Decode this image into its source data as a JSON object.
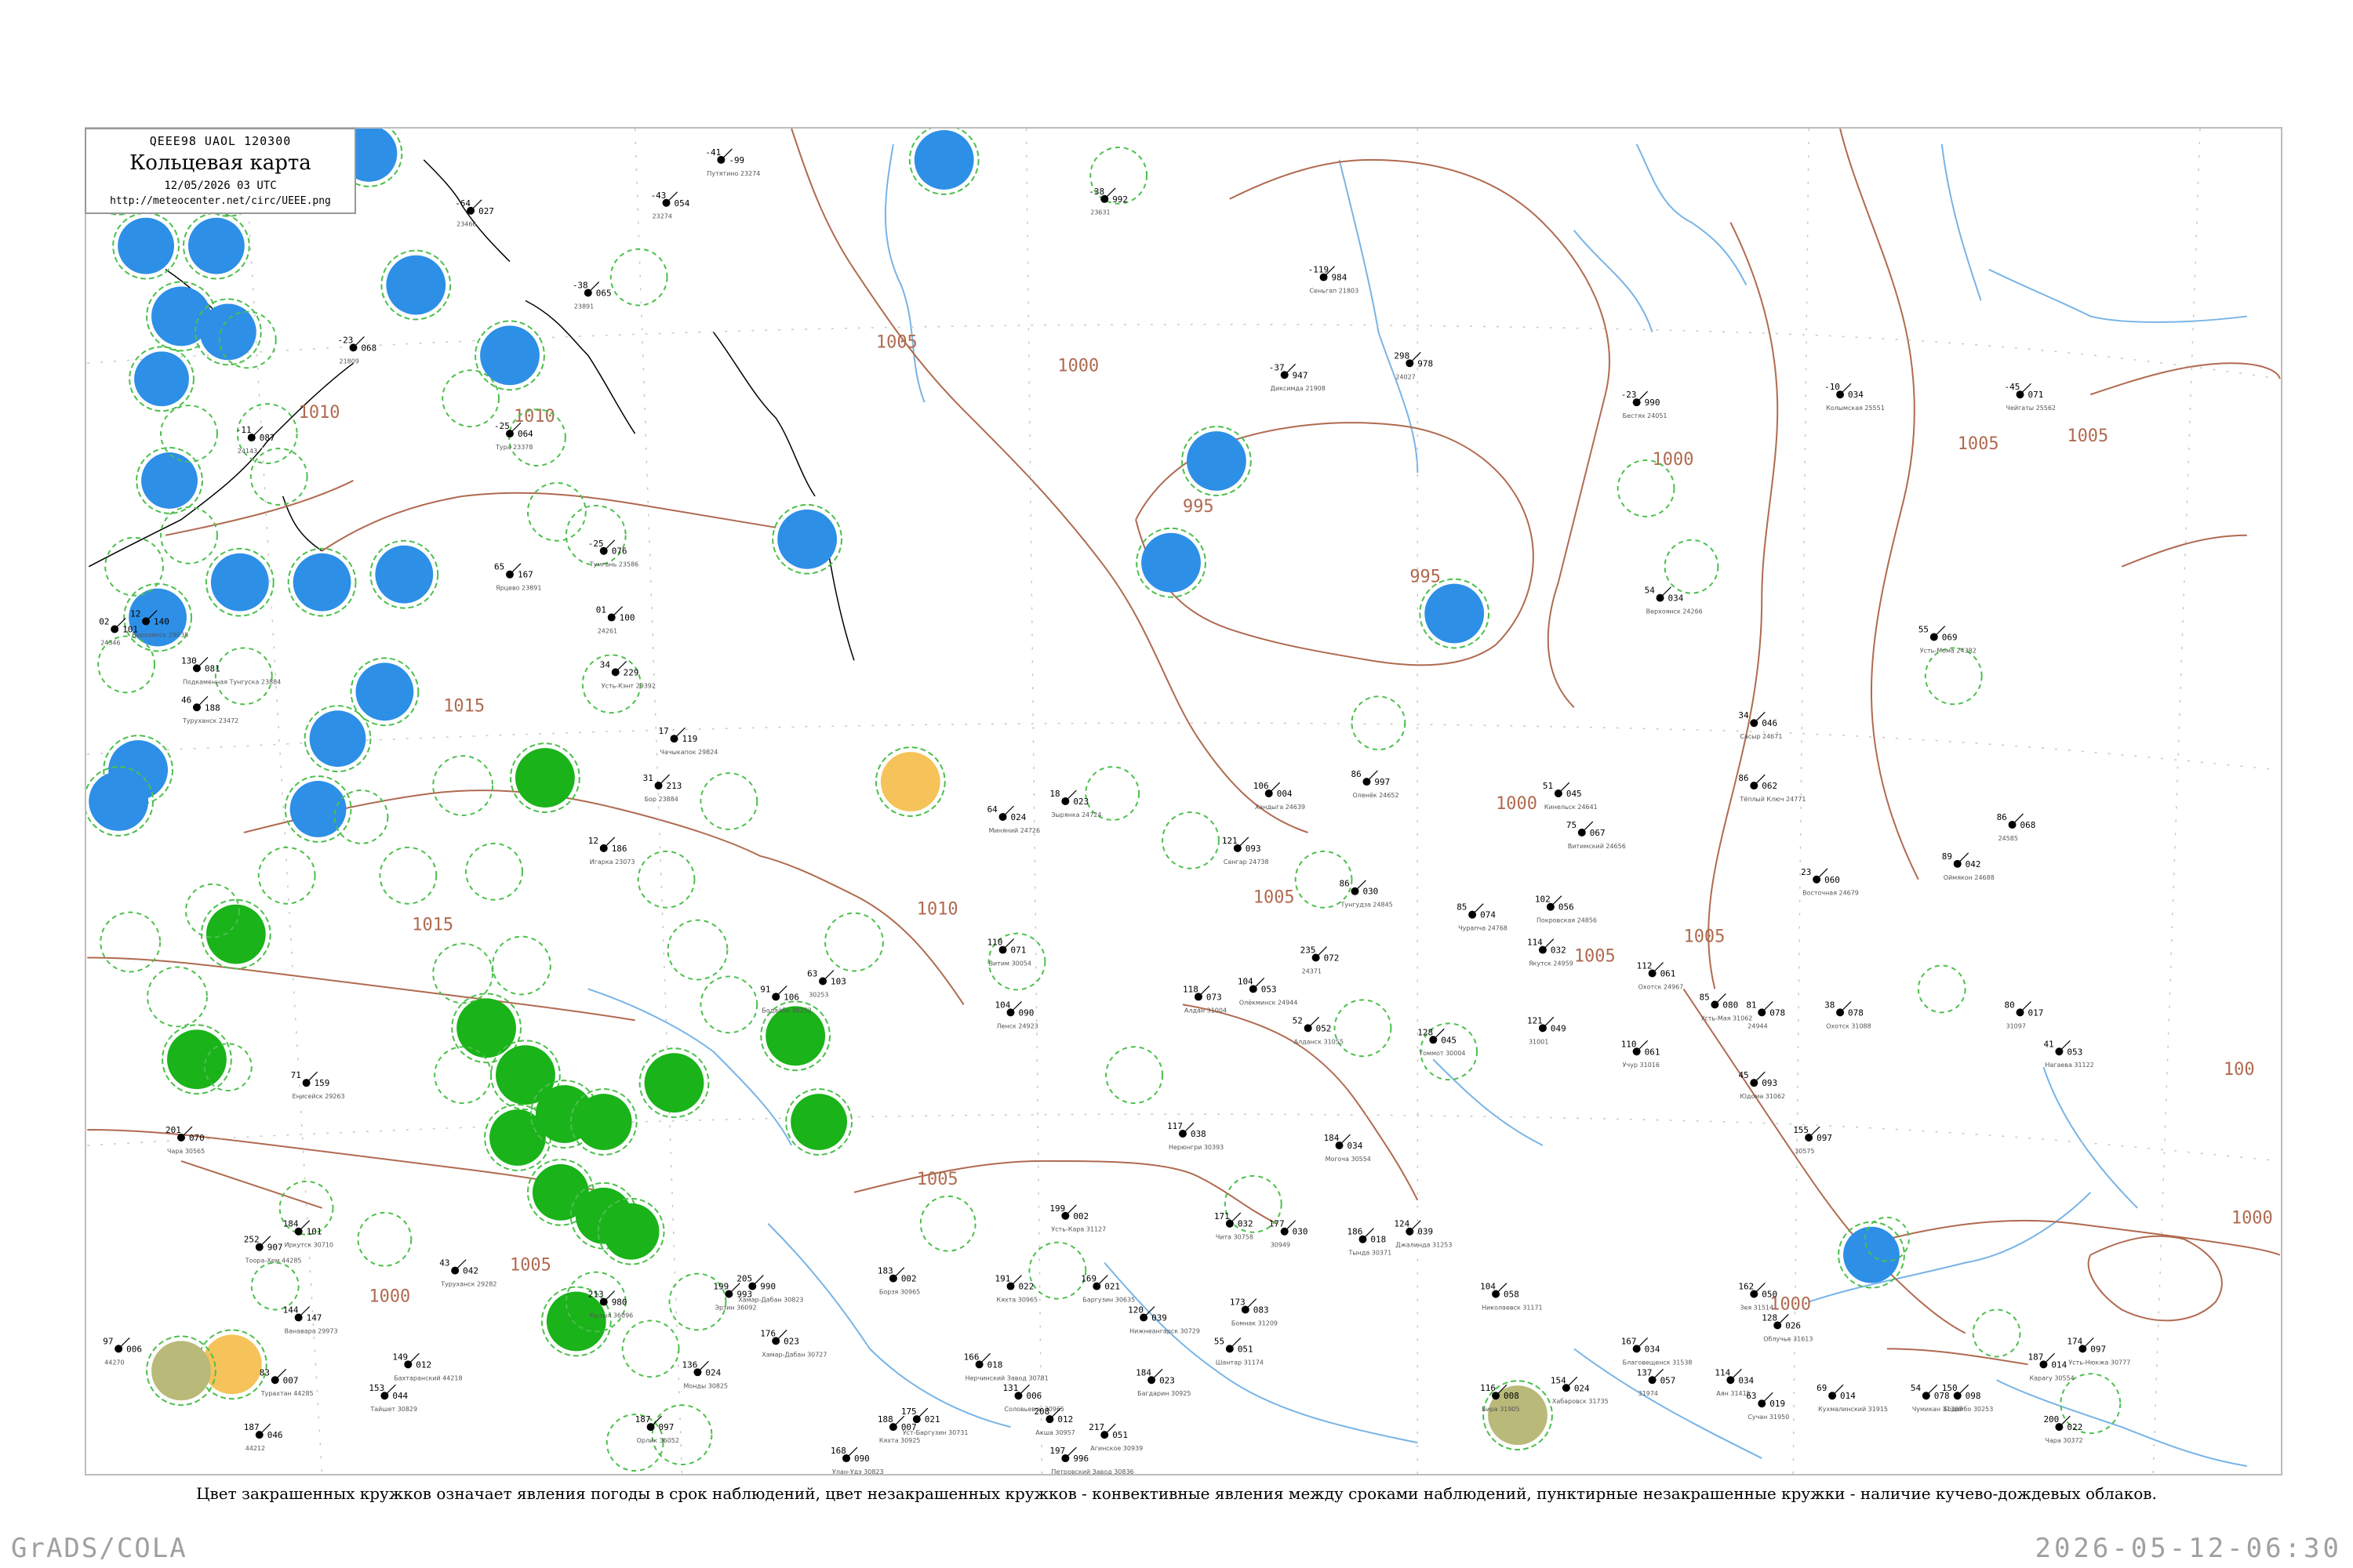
{
  "title_box": {
    "code": "QEEE98  UAOL  120300",
    "title": "Кольцевая карта",
    "datetime": "12/05/2026 03 UTC",
    "url": "http://meteocenter.net/circ/UEEE.png"
  },
  "caption": "Цвет закрашенных кружков означает явления погоды в срок наблюдений, цвет незакрашенных кружков - конвективные явления между сроками наблюдений, пунктирные незакрашенные кружки - наличие кучево-дождевых облаков.",
  "footer": {
    "left": "GrADS/COLA",
    "right": "2026-05-12-06:30"
  },
  "colors": {
    "frame": "#bdbdbd",
    "isobar": "#b06a50",
    "river": "#78b4e6",
    "shower_circle": "#2e8fe6",
    "thunder_circle": "#1ab31a",
    "fog_circle": "#f5c35a",
    "haze_circle": "#b9b97a",
    "convective_ring": "#4cbf4c"
  },
  "isobar_labels": [
    "1005",
    "1000",
    "1010",
    "1010",
    "995",
    "1015",
    "1015",
    "1010",
    "1005",
    "1005",
    "1000",
    "995",
    "1000",
    "1005",
    "1000",
    "1005",
    "1005",
    "1005",
    "1000",
    "1005",
    "100",
    "1000"
  ],
  "stations": [
    {
      "t": "-41",
      "p": "-99",
      "name": "Путятино 23274"
    },
    {
      "t": "-64",
      "p": "027",
      "name": "23466"
    },
    {
      "t": "-43",
      "p": "054",
      "name": "23274"
    },
    {
      "t": "-38",
      "p": "992",
      "name": "23631"
    },
    {
      "t": "-119",
      "p": "984",
      "name": "Сеньгап 21803"
    },
    {
      "t": "-23",
      "p": "068",
      "name": "21809"
    },
    {
      "t": "-37",
      "p": "947",
      "name": "Диксимда 21908"
    },
    {
      "t": "298",
      "p": "978",
      "name": "24027"
    },
    {
      "t": "-23",
      "p": "990",
      "name": "Бестях 24051"
    },
    {
      "t": "-10",
      "p": "034",
      "name": "Колымская 25551"
    },
    {
      "t": "-45",
      "p": "071",
      "name": "Чейгаты 25562"
    },
    {
      "t": "-25",
      "p": "064",
      "name": "Тура 23378"
    },
    {
      "t": "-38",
      "p": "065",
      "name": "23891"
    },
    {
      "t": "-11",
      "p": "087",
      "name": "24143"
    },
    {
      "t": "-25",
      "p": "076",
      "name": "Тумгань 23586"
    },
    {
      "t": "01",
      "p": "100",
      "name": "24261"
    },
    {
      "t": "02",
      "p": "101",
      "name": "24346"
    },
    {
      "t": "12",
      "p": "140",
      "name": "Верхоянск 29038"
    },
    {
      "t": "54",
      "p": "034",
      "name": "Верхоянск 24266"
    },
    {
      "t": "55",
      "p": "069",
      "name": "Усть-Мома 24382"
    },
    {
      "t": "34",
      "p": "229",
      "name": "Усть-Кэнт 29392"
    },
    {
      "t": "17",
      "p": "119",
      "name": "Чачыкапок 29824"
    },
    {
      "t": "18",
      "p": "023",
      "name": "Зырянка 24724"
    },
    {
      "t": "86",
      "p": "997",
      "name": "Оленёк 24652"
    },
    {
      "t": "106",
      "p": "004",
      "name": "Хандыга 24639"
    },
    {
      "t": "64",
      "p": "024",
      "name": "Миняний 24726"
    },
    {
      "t": "121",
      "p": "093",
      "name": "Сангар 24738"
    },
    {
      "t": "51",
      "p": "045",
      "name": "Кинельск 24641"
    },
    {
      "t": "75",
      "p": "067",
      "name": "Витимский 24656"
    },
    {
      "t": "34",
      "p": "046",
      "name": "Сасыр 24671"
    },
    {
      "t": "86",
      "p": "062",
      "name": "Тёплый Ключ 24771"
    },
    {
      "t": "23",
      "p": "060",
      "name": "Восточная 24679"
    },
    {
      "t": "89",
      "p": "042",
      "name": "Оймякон 24688"
    },
    {
      "t": "86",
      "p": "068",
      "name": "24585"
    },
    {
      "t": "86",
      "p": "030",
      "name": "Тунгудза 24845"
    },
    {
      "t": "102",
      "p": "056",
      "name": "Покровская 24856"
    },
    {
      "t": "85",
      "p": "074",
      "name": "Чурапча 24768"
    },
    {
      "t": "114",
      "p": "032",
      "name": "Якутск 24959"
    },
    {
      "t": "235",
      "p": "072",
      "name": "24371"
    },
    {
      "t": "110",
      "p": "071",
      "name": "Витим 30054"
    },
    {
      "t": "104",
      "p": "090",
      "name": "Ленск 24923"
    },
    {
      "t": "91",
      "p": "106",
      "name": "Бодайбо 30252"
    },
    {
      "t": "63",
      "p": "103",
      "name": "30253"
    },
    {
      "t": "118",
      "p": "073",
      "name": "Алдан 31004"
    },
    {
      "t": "104",
      "p": "053",
      "name": "Олёкминск 24944"
    },
    {
      "t": "52",
      "p": "052",
      "name": "Алданск 31055"
    },
    {
      "t": "128",
      "p": "045",
      "name": "Томмот 30004"
    },
    {
      "t": "121",
      "p": "049",
      "name": "31001"
    },
    {
      "t": "110",
      "p": "061",
      "name": "Учур 31016"
    },
    {
      "t": "112",
      "p": "061",
      "name": "Охотск 24967"
    },
    {
      "t": "85",
      "p": "080",
      "name": "Усть-Мая 31062"
    },
    {
      "t": "81",
      "p": "078",
      "name": "24944"
    },
    {
      "t": "45",
      "p": "093",
      "name": "Юдома 31062"
    },
    {
      "t": "38",
      "p": "078",
      "name": "Охотск 31088"
    },
    {
      "t": "80",
      "p": "017",
      "name": "31097"
    },
    {
      "t": "41",
      "p": "053",
      "name": "Нагаева 31122"
    },
    {
      "t": "155",
      "p": "097",
      "name": "30575"
    },
    {
      "t": "117",
      "p": "038",
      "name": "Нерюнгри 30393"
    },
    {
      "t": "184",
      "p": "034",
      "name": "Могоча 30554"
    },
    {
      "t": "171",
      "p": "032",
      "name": "Чита 30758"
    },
    {
      "t": "177",
      "p": "030",
      "name": "30949"
    },
    {
      "t": "186",
      "p": "018",
      "name": "Тында 30371"
    },
    {
      "t": "124",
      "p": "039",
      "name": "Джалинда 31253"
    },
    {
      "t": "173",
      "p": "083",
      "name": "Бомнак 31209"
    },
    {
      "t": "104",
      "p": "058",
      "name": "Николаевск 31171"
    },
    {
      "t": "55",
      "p": "051",
      "name": "Шантар 31174"
    },
    {
      "t": "167",
      "p": "034",
      "name": "Благовещенск 31538"
    },
    {
      "t": "162",
      "p": "050",
      "name": "Зея 31514"
    },
    {
      "t": "128",
      "p": "026",
      "name": "Облучье 31613"
    },
    {
      "t": "116",
      "p": "008",
      "name": "Бира 31905"
    },
    {
      "t": "154",
      "p": "024",
      "name": "Хабаровск 31735"
    },
    {
      "t": "137",
      "p": "057",
      "name": "31974"
    },
    {
      "t": "114",
      "p": "034",
      "name": "Аян 31415"
    },
    {
      "t": "63",
      "p": "019",
      "name": "Сучан 31950"
    },
    {
      "t": "69",
      "p": "014",
      "name": "Кухмалинский 31915"
    },
    {
      "t": "54",
      "p": "078",
      "name": "Чумикан 31369"
    },
    {
      "t": "150",
      "p": "098",
      "name": "Бодайбо 30253"
    },
    {
      "t": "187",
      "p": "014",
      "name": "Карагу 30554"
    },
    {
      "t": "200",
      "p": "022",
      "name": "Чара 30372"
    },
    {
      "t": "174",
      "p": "097",
      "name": "Усть-Нюкжа 30777"
    },
    {
      "t": "201",
      "p": "070",
      "name": "Чара 30565"
    },
    {
      "t": "199",
      "p": "002",
      "name": "Усть-Кара 31127"
    },
    {
      "t": "169",
      "p": "021",
      "name": "Баргузин 30635"
    },
    {
      "t": "120",
      "p": "039",
      "name": "Нижнеангарск 30729"
    },
    {
      "t": "184",
      "p": "023",
      "name": "Багдарин 30925"
    },
    {
      "t": "191",
      "p": "022",
      "name": "Кяхта 30965"
    },
    {
      "t": "183",
      "p": "002",
      "name": "Борзя 30965"
    },
    {
      "t": "166",
      "p": "018",
      "name": "Нерчинский Завод 30781"
    },
    {
      "t": "131",
      "p": "006",
      "name": "Соловьевск 30965"
    },
    {
      "t": "208",
      "p": "012",
      "name": "Акша 30957"
    },
    {
      "t": "217",
      "p": "051",
      "name": "Агинское 30939"
    },
    {
      "t": "197",
      "p": "996",
      "name": "Петровский Завод 30836"
    },
    {
      "t": "188",
      "p": "007",
      "name": "Кяхта 30925"
    },
    {
      "t": "168",
      "p": "090",
      "name": "Улан-Удэ 30823"
    },
    {
      "t": "175",
      "p": "021",
      "name": "Уст-Баргузин 30731"
    },
    {
      "t": "176",
      "p": "023",
      "name": "Хамар-Дабан 30727"
    },
    {
      "t": "136",
      "p": "024",
      "name": "Монды 30825"
    },
    {
      "t": "187",
      "p": "097",
      "name": "Орлик 36052"
    },
    {
      "t": "205",
      "p": "990",
      "name": "Хамар-Дабан 30823"
    },
    {
      "t": "213",
      "p": "980",
      "name": "Кызыл 36096"
    },
    {
      "t": "199",
      "p": "993",
      "name": "Эрзин 36092"
    },
    {
      "t": "252",
      "p": "907",
      "name": "Тоора-Хем 44285"
    },
    {
      "t": "184",
      "p": "101",
      "name": "Иркутск 30710"
    },
    {
      "t": "149",
      "p": "012",
      "name": "Бахтаранский 44218"
    },
    {
      "t": "187",
      "p": "046",
      "name": "44212"
    },
    {
      "t": "97",
      "p": "006",
      "name": "44270"
    },
    {
      "t": "83",
      "p": "007",
      "name": "Турахтан 44285"
    },
    {
      "t": "153",
      "p": "044",
      "name": "Тайшет 30829"
    },
    {
      "t": "144",
      "p": "147",
      "name": "Ванавара 29973"
    },
    {
      "t": "43",
      "p": "042",
      "name": "Туруханск 29282"
    },
    {
      "t": "71",
      "p": "159",
      "name": "Енисейск 29263"
    },
    {
      "t": "12",
      "p": "186",
      "name": "Игарка 23073"
    },
    {
      "t": "31",
      "p": "213",
      "name": "Бор 23884"
    },
    {
      "t": "65",
      "p": "167",
      "name": "Ярцево 23891"
    },
    {
      "t": "46",
      "p": "188",
      "name": "Туруханск 23472"
    },
    {
      "t": "130",
      "p": "081",
      "name": "Подкаменная Тунгуска 23884"
    }
  ]
}
